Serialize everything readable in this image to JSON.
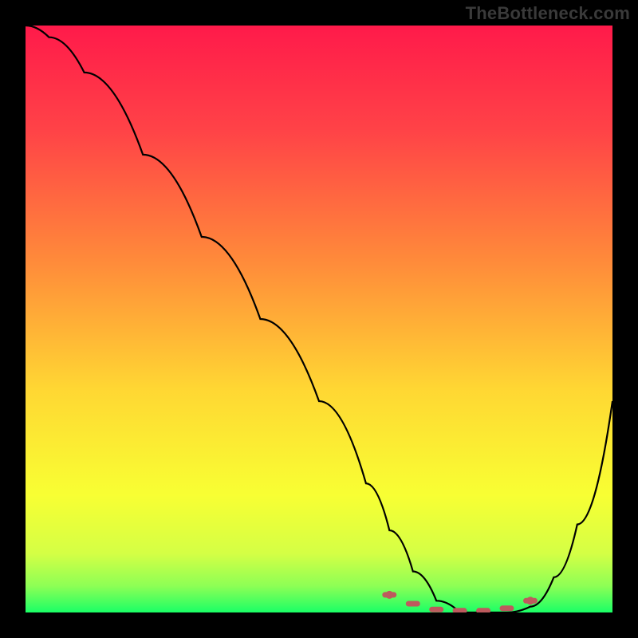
{
  "watermark": "TheBottleneck.com",
  "colors": {
    "frame": "#000000",
    "curve_line": "#000000",
    "dotted_line": "#bd5a5d",
    "gradient_stops": [
      {
        "offset": 0.0,
        "color": "#ff1a4a"
      },
      {
        "offset": 0.18,
        "color": "#ff4347"
      },
      {
        "offset": 0.4,
        "color": "#ff8a3a"
      },
      {
        "offset": 0.62,
        "color": "#ffd733"
      },
      {
        "offset": 0.8,
        "color": "#f8ff33"
      },
      {
        "offset": 0.9,
        "color": "#d4ff45"
      },
      {
        "offset": 0.955,
        "color": "#8dff55"
      },
      {
        "offset": 1.0,
        "color": "#1aff66"
      }
    ]
  },
  "chart_data": {
    "type": "line",
    "title": "",
    "xlabel": "",
    "ylabel": "",
    "xlim": [
      0,
      100
    ],
    "ylim": [
      0,
      100
    ],
    "grid": false,
    "series": [
      {
        "name": "bottleneck-curve",
        "x": [
          0,
          4,
          10,
          20,
          30,
          40,
          50,
          58,
          62,
          66,
          70,
          74,
          78,
          82,
          86,
          90,
          94,
          100
        ],
        "y": [
          100,
          98,
          92,
          78,
          64,
          50,
          36,
          22,
          14,
          7,
          2,
          0,
          0,
          0,
          1,
          6,
          15,
          36
        ]
      }
    ],
    "annotations": [
      {
        "name": "optimal-flat-region",
        "style": "dotted",
        "x": [
          62,
          66,
          70,
          74,
          78,
          82,
          86
        ],
        "y": [
          3,
          1.5,
          0.5,
          0.3,
          0.3,
          0.7,
          2
        ]
      }
    ]
  }
}
